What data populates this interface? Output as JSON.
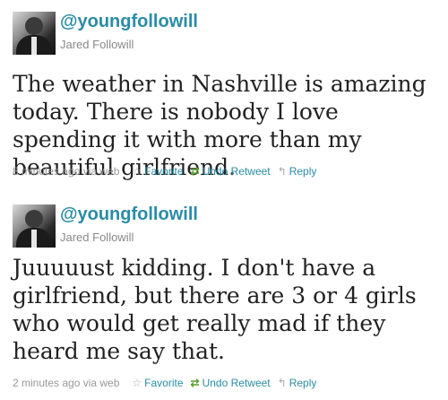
{
  "tweets": [
    {
      "handle": "@youngfollowill",
      "name": "Jared Followill",
      "text": "The weather in Nashville is amazing today. There is nobody I love spending it with more than my beautiful girlfriend.",
      "time": "8 minutes ago via web",
      "actions": {
        "favorite": "Favorite",
        "undo_retweet": "Undo Retweet",
        "reply": "Reply"
      }
    },
    {
      "handle": "@youngfollowill",
      "name": "Jared Followill",
      "text": "Juuuuust kidding. I don't have a girlfriend, but there are 3 or 4 girls who would get really mad if they heard me say that.",
      "time": "2 minutes ago via web",
      "actions": {
        "favorite": "Favorite",
        "undo_retweet": "Undo Retweet",
        "reply": "Reply"
      }
    }
  ],
  "icons": {
    "favorite": "star-icon",
    "undo_retweet": "retweet-icon",
    "reply": "reply-arrow-icon"
  },
  "colors": {
    "link": "#2a8ca6",
    "meta": "#999999",
    "text": "#222222",
    "retweet": "#5aa02c"
  }
}
